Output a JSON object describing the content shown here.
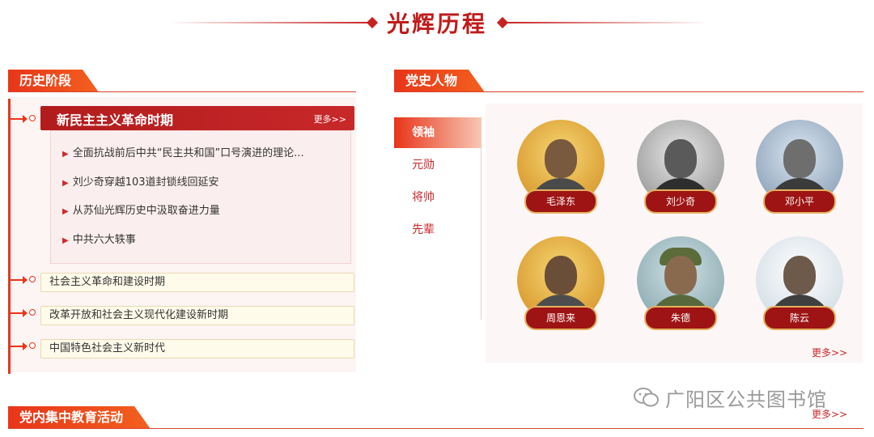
{
  "banner": {
    "title": "光辉历程"
  },
  "sections": {
    "history": {
      "label": "历史阶段"
    },
    "people": {
      "label": "党史人物"
    },
    "education": {
      "label": "党内集中教育活动"
    }
  },
  "periods": {
    "active": {
      "title": "新民主主义革命时期",
      "more": "更多>>",
      "items": [
        "全面抗战前后中共“民主共和国”口号演进的理论...",
        "刘少奇穿越103道封锁线回延安",
        "从苏仙光辉历史中汲取奋进力量",
        "中共六大轶事"
      ]
    },
    "others": [
      "社会主义革命和建设时期",
      "改革开放和社会主义现代化建设新时期",
      "中国特色社会主义新时代"
    ]
  },
  "categories": {
    "items": [
      "领袖",
      "元勋",
      "将帅",
      "先辈"
    ],
    "active_index": 0
  },
  "people": [
    {
      "name": "毛泽东"
    },
    {
      "name": "刘少奇"
    },
    {
      "name": "邓小平"
    },
    {
      "name": "周恩来"
    },
    {
      "name": "朱德"
    },
    {
      "name": "陈云"
    }
  ],
  "people_more": "更多>>",
  "education_more": "更多>>",
  "watermark": {
    "text": "广阳区公共图书馆",
    "icon": "wechat-icon"
  },
  "colors": {
    "accent": "#c62222",
    "tab": "#e8351a",
    "nameplate": "#9e1414",
    "gold": "#e4b25f"
  }
}
